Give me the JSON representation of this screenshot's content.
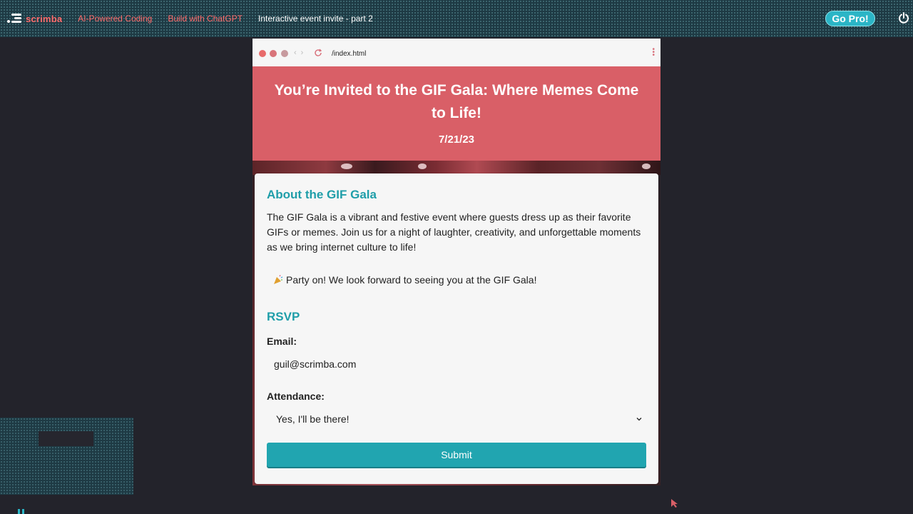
{
  "topbar": {
    "brand": "scrimba",
    "breadcrumbs": [
      "AI-Powered Coding",
      "Build with ChatGPT"
    ],
    "current": "Interactive event invite - part 2",
    "go_pro": "Go Pro!",
    "icons": [
      "scrimba-logo-icon",
      "power-icon"
    ]
  },
  "browser": {
    "url": "/index.html",
    "icons": [
      "close-dot",
      "minimize-dot",
      "maximize-dot",
      "reload-icon",
      "menu-dots-icon"
    ]
  },
  "hero": {
    "title": "You’re Invited to the GIF Gala: Where Memes Come to Life!",
    "date": "7/21/23"
  },
  "about": {
    "heading": "About the GIF Gala",
    "text": "The GIF Gala is a vibrant and festive event where guests dress up as their favorite GIFs or memes. Join us for a night of laughter, creativity, and unforgettable moments as we bring internet culture to life!",
    "party_text": "Party on! We look forward to seeing you at the GIF Gala!",
    "party_icon": "party-popper-icon"
  },
  "rsvp": {
    "heading": "RSVP",
    "email_label": "Email:",
    "email_value": "guil@scrimba.com",
    "attendance_label": "Attendance:",
    "attendance_value": "Yes, I'll be there!",
    "submit_label": "Submit"
  },
  "colors": {
    "accent": "#21a5b0",
    "hero": "#d95f67",
    "brand_link": "#ff6b6b"
  }
}
